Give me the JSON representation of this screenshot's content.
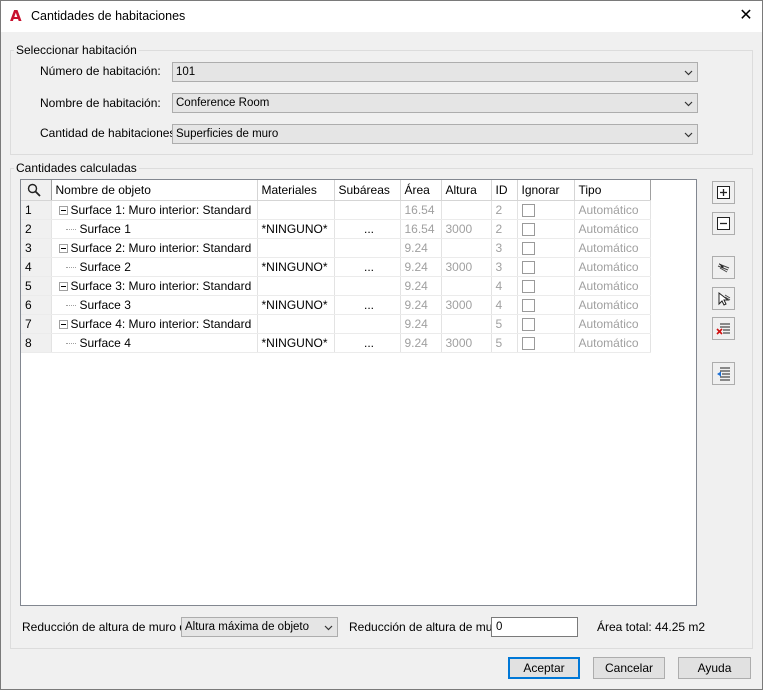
{
  "window": {
    "title": "Cantidades de habitaciones",
    "app_icon": "autocad-a-icon",
    "close_symbol": "✕"
  },
  "select_room": {
    "group_label": "Seleccionar habitación",
    "room_number_label": "Número de habitación:",
    "room_number_value": "101",
    "room_name_label": "Nombre de habitación:",
    "room_name_value": "Conference Room",
    "room_quantity_label": "Cantidad de habitaciones:",
    "room_quantity_value": "Superficies de muro"
  },
  "calculated": {
    "group_label": "Cantidades calculadas",
    "columns": [
      "Nombre de objeto",
      "Materiales",
      "Subáreas",
      "Área",
      "Altura",
      "ID",
      "Ignorar",
      "Tipo"
    ],
    "rows": [
      {
        "num": "1",
        "level": 0,
        "name": "Surface 1: Muro interior: Standard",
        "material": "",
        "subareas": "",
        "area": "16.54",
        "height": "",
        "id": "2",
        "ignore": false,
        "type": "Automático"
      },
      {
        "num": "2",
        "level": 1,
        "name": "Surface 1",
        "material": "*NINGUNO*",
        "subareas": "...",
        "area": "16.54",
        "height": "3000",
        "id": "2",
        "ignore": false,
        "type": "Automático"
      },
      {
        "num": "3",
        "level": 0,
        "name": "Surface 2: Muro interior: Standard",
        "material": "",
        "subareas": "",
        "area": "9.24",
        "height": "",
        "id": "3",
        "ignore": false,
        "type": "Automático"
      },
      {
        "num": "4",
        "level": 1,
        "name": "Surface 2",
        "material": "*NINGUNO*",
        "subareas": "...",
        "area": "9.24",
        "height": "3000",
        "id": "3",
        "ignore": false,
        "type": "Automático"
      },
      {
        "num": "5",
        "level": 0,
        "name": "Surface 3: Muro interior: Standard",
        "material": "",
        "subareas": "",
        "area": "9.24",
        "height": "",
        "id": "4",
        "ignore": false,
        "type": "Automático"
      },
      {
        "num": "6",
        "level": 1,
        "name": "Surface 3",
        "material": "*NINGUNO*",
        "subareas": "...",
        "area": "9.24",
        "height": "3000",
        "id": "4",
        "ignore": false,
        "type": "Automático"
      },
      {
        "num": "7",
        "level": 0,
        "name": "Surface 4: Muro interior: Standard",
        "material": "",
        "subareas": "",
        "area": "9.24",
        "height": "",
        "id": "5",
        "ignore": false,
        "type": "Automático"
      },
      {
        "num": "8",
        "level": 1,
        "name": "Surface 4",
        "material": "*NINGUNO*",
        "subareas": "...",
        "area": "9.24",
        "height": "3000",
        "id": "5",
        "ignore": false,
        "type": "Automático"
      }
    ]
  },
  "side_buttons": [
    "add-row-icon",
    "remove-row-icon",
    "select-objects-icon",
    "pick-objects-icon",
    "delete-list-icon",
    "import-list-icon"
  ],
  "footer": {
    "wall_height_reduction_from_label": "Reducción de altura de muro de",
    "wall_height_reduction_from_value": "Altura máxima de objeto",
    "wall_height_reduction_label": "Reducción de altura de muro",
    "wall_height_reduction_value": "0",
    "total_area": "Área total: 44.25 m2"
  },
  "buttons": {
    "accept": "Aceptar",
    "cancel": "Cancelar",
    "help": "Ayuda"
  },
  "colors": {
    "accent": "#0078d7",
    "app_icon": "#c8102e",
    "disabled_text": "#a0a0a0"
  }
}
